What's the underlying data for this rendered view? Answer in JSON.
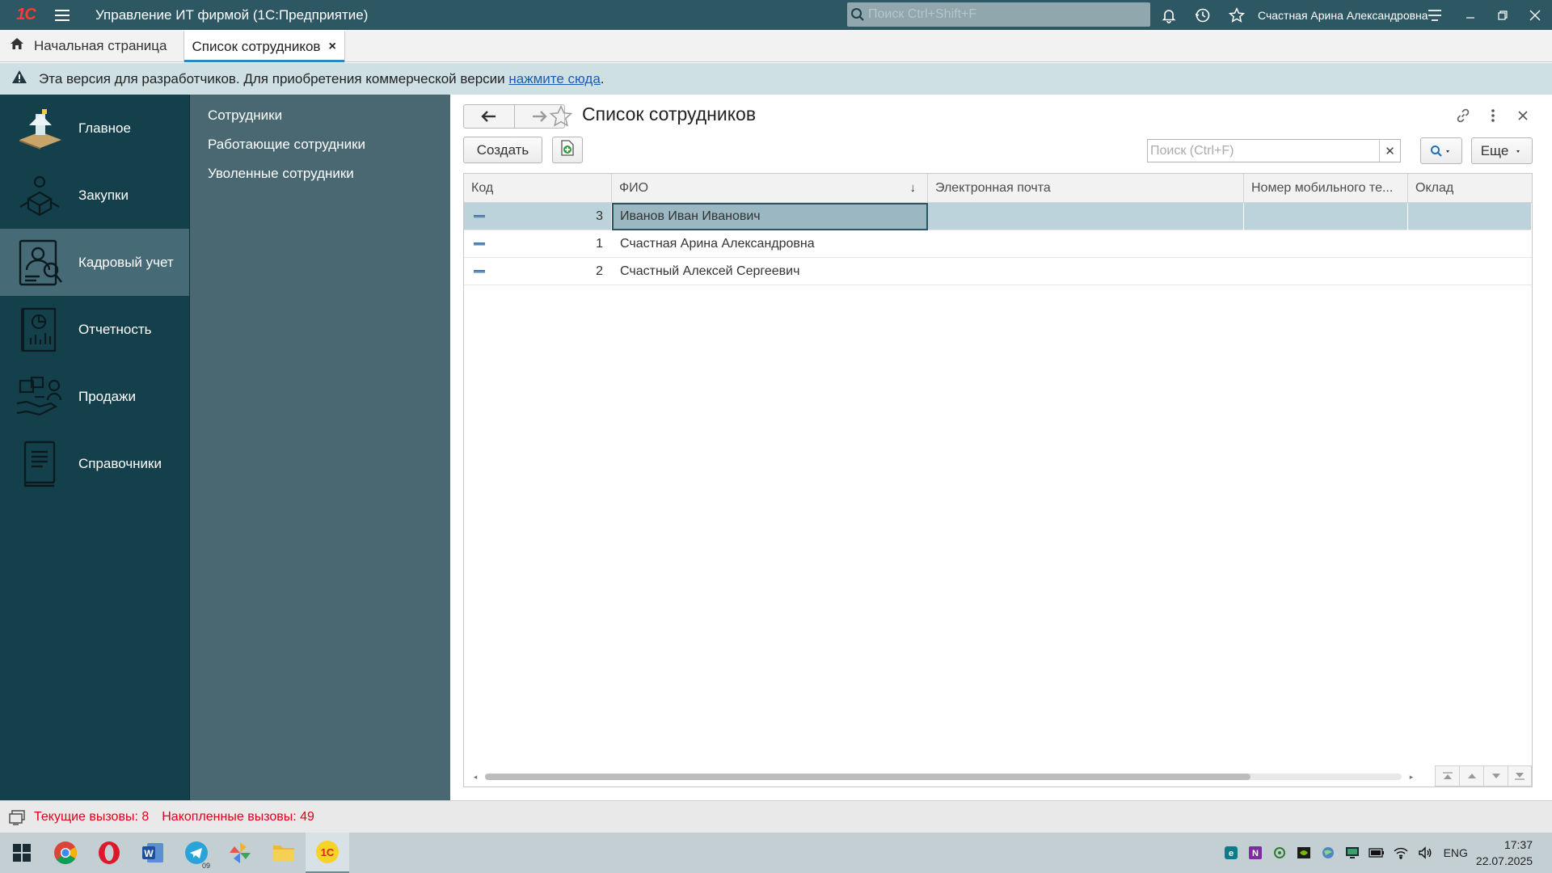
{
  "titlebar": {
    "app_title": "Управление ИТ фирмой  (1С:Предприятие)",
    "search_placeholder": "Поиск Ctrl+Shift+F",
    "user": "Счастная Арина Александровна",
    "logo_text": "1С"
  },
  "tabs": {
    "home_label": "Начальная страница",
    "active_label": "Список сотрудников",
    "close_glyph": "×"
  },
  "notice": {
    "text": "Эта версия для разработчиков. Для приобретения коммерческой версии ",
    "link": "нажмите сюда",
    "tail": "."
  },
  "sections": [
    {
      "label": "Главное",
      "icon": "home-desk-icon"
    },
    {
      "label": "Закупки",
      "icon": "purchases-icon"
    },
    {
      "label": "Кадровый учет",
      "icon": "hr-icon",
      "active": true
    },
    {
      "label": "Отчетность",
      "icon": "report-icon"
    },
    {
      "label": "Продажи",
      "icon": "sales-icon"
    },
    {
      "label": "Справочники",
      "icon": "book-icon"
    }
  ],
  "submenu": [
    "Сотрудники",
    "Работающие сотрудники",
    "Уволенные сотрудники"
  ],
  "form": {
    "title": "Список сотрудников",
    "create_label": "Создать",
    "search_placeholder": "Поиск (Ctrl+F)",
    "more_label": "Еще",
    "sort_glyph": "↓"
  },
  "table": {
    "columns": [
      "Код",
      "ФИО",
      "Электронная почта",
      "Номер мобильного те...",
      "Оклад"
    ],
    "rows": [
      {
        "code": "3",
        "fio": "Иванов Иван Иванович",
        "email": "",
        "phone": "",
        "salary": "",
        "selected": true
      },
      {
        "code": "1",
        "fio": "Счастная Арина Александровна",
        "email": "",
        "phone": "",
        "salary": ""
      },
      {
        "code": "2",
        "fio": "Счастный Алексей Сергеевич",
        "email": "",
        "phone": "",
        "salary": ""
      }
    ]
  },
  "statusbar": {
    "current_calls": "Текущие вызовы: 8",
    "accumulated_calls": "Накопленные вызовы: 49"
  },
  "taskbar": {
    "lang": "ENG",
    "time": "17:37",
    "date": "22.07.2025",
    "telegram_badge": "09"
  },
  "colors": {
    "titlebar": "#2c5763",
    "sections_bg": "#14404c",
    "sections_active": "#466a76",
    "submenu_bg": "#4a6872",
    "selected_row": "#bcd3db",
    "status_text": "#e0001a"
  }
}
